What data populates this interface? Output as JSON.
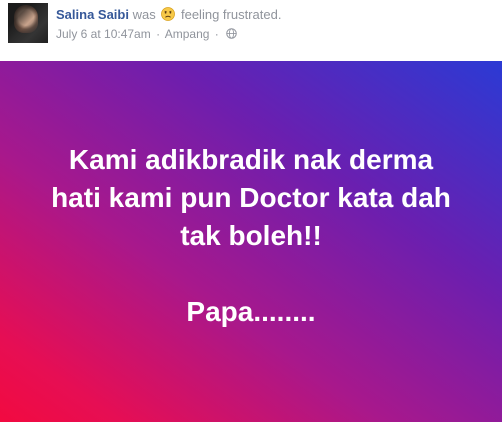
{
  "post": {
    "author": "Salina Saibi",
    "was": "was",
    "feeling": "feeling frustrated.",
    "feeling_icon": "frustrated-face-emoji",
    "date": "July 6 at 10:47am",
    "separator": "·",
    "location": "Ampang",
    "separator2": "·",
    "privacy_icon": "globe-icon",
    "status": {
      "line1": "Kami adikbradik nak derma",
      "line2": "hati kami pun Doctor kata dah",
      "line3": "tak boleh!!",
      "signoff": "Papa........"
    },
    "colors": {
      "author": "#365899",
      "meta": "#90949c",
      "gradient_start": "#2b3ad4",
      "gradient_mid": "#a8188c",
      "gradient_end": "#f20a40"
    }
  }
}
